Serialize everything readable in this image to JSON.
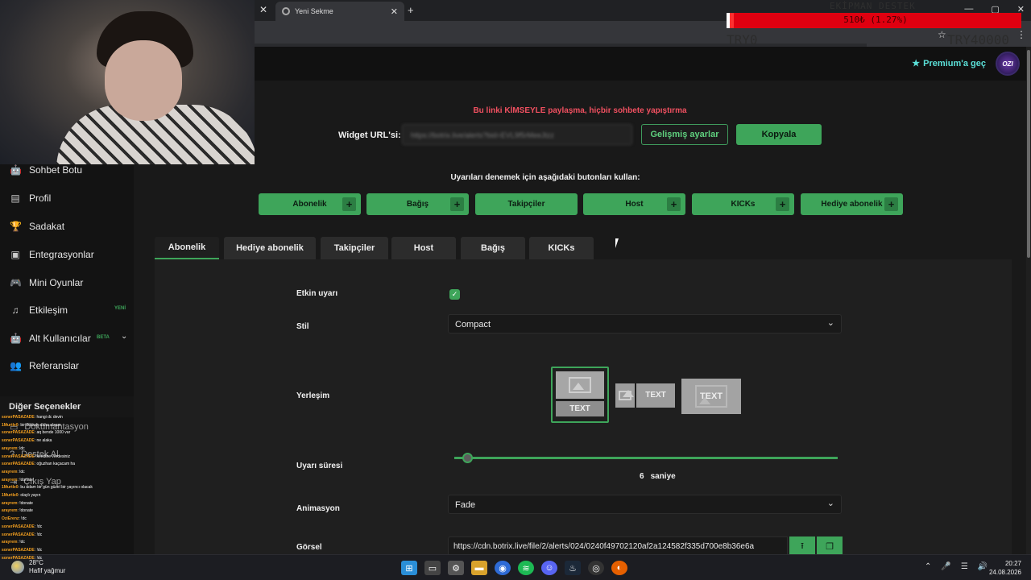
{
  "browser": {
    "tab_title": "Yeni Sekme",
    "new_tab": "+",
    "close_glyph": "✕",
    "window_controls": [
      "—",
      "▢",
      "✕"
    ]
  },
  "donation_overlay": {
    "title": "EKİPMAN DESTEK",
    "progress_text": "510₺ (1.27%)",
    "progress_percent": 1.27,
    "current": "TRY0",
    "goal": "TRY40000",
    "color": "#e00010"
  },
  "header": {
    "premium_label": "Premium'a geç",
    "avatar_text": "OZI"
  },
  "sidebar": {
    "items": [
      {
        "label": "Sohbet Botu",
        "icon": "robot-icon",
        "glyph": "🤖"
      },
      {
        "label": "Profil",
        "icon": "profile-card-icon",
        "glyph": "▤"
      },
      {
        "label": "Sadakat",
        "icon": "trophy-icon",
        "glyph": "🏆"
      },
      {
        "label": "Entegrasyonlar",
        "icon": "integration-icon",
        "glyph": "▣"
      },
      {
        "label": "Mini Oyunlar",
        "icon": "gamepad-icon",
        "glyph": "🎮"
      },
      {
        "label": "Etkileşim",
        "icon": "music-icon",
        "glyph": "♫",
        "badge": "YENİ"
      },
      {
        "label": "Alt Kullanıcılar",
        "icon": "robot-icon",
        "glyph": "🤖",
        "badge": "BETA"
      },
      {
        "label": "Referanslar",
        "icon": "users-icon",
        "glyph": "👥"
      }
    ],
    "other_options_title": "Diğer Seçenekler",
    "other_items": [
      "Dokümantasyon",
      "Destek Al",
      "Çıkış Yap"
    ]
  },
  "chat": [
    {
      "user": "sonerPASAZADE",
      "text": ": hangi dc devin"
    },
    {
      "user": "1Murtle0",
      "text": ": bir dükkan daha alsam"
    },
    {
      "user": "sonerPASAZADE",
      "text": ": aq bende 1000 var"
    },
    {
      "user": "sonerPASAZADE",
      "text": ": ne alaka"
    },
    {
      "user": "arayrem",
      "text": ": ldc"
    },
    {
      "user": "sonerPASAZADE",
      "text": ": kendine verdesiniz"
    },
    {
      "user": "sonerPASAZADE",
      "text": ": oğuzhan kaçacam ha"
    },
    {
      "user": "arayrem",
      "text": ": ldc"
    },
    {
      "user": "arayrem",
      "text": ": !donate"
    },
    {
      "user": "1Murtle0",
      "text": ": bu adam bir gün güzel bir yayıncı olacak"
    },
    {
      "user": "1Murtle0",
      "text": ": olaylı yayın"
    },
    {
      "user": "arayrem",
      "text": ": !donate"
    },
    {
      "user": "arayrem",
      "text": ": !donate"
    },
    {
      "user": "OziErenz",
      "text": ": !dc"
    },
    {
      "user": "sonerPASAZADE",
      "text": ": !dc"
    },
    {
      "user": "sonerPASAZADE",
      "text": ": !dc"
    },
    {
      "user": "arayrem",
      "text": ": !dc"
    },
    {
      "user": "sonerPASAZADE",
      "text": ": !dc"
    },
    {
      "user": "sonerPASAZADE",
      "text": ": !dc"
    }
  ],
  "widget": {
    "warning": "Bu linki KİMSEYLE paylaşma, hiçbir sohbete yapıştırma",
    "url_label": "Widget URL'si:",
    "url_value": "https://botrix.live/alerts?bid=EVL9f5rMeeJtzz",
    "advanced_label": "Gelişmiş ayarlar",
    "copy_label": "Kopyala"
  },
  "test": {
    "label": "Uyarıları denemek için aşağıdaki butonları kullan:",
    "buttons": [
      {
        "label": "Abonelik",
        "plus": true
      },
      {
        "label": "Bağış",
        "plus": true
      },
      {
        "label": "Takipçiler",
        "plus": false
      },
      {
        "label": "Host",
        "plus": true
      },
      {
        "label": "KICKs",
        "plus": true
      },
      {
        "label": "Hediye abonelik",
        "plus": true
      }
    ]
  },
  "tabs": [
    {
      "label": "Abonelik",
      "active": true
    },
    {
      "label": "Hediye abonelik",
      "active": false
    },
    {
      "label": "Takipçiler",
      "active": false
    },
    {
      "label": "Host",
      "active": false
    },
    {
      "label": "Bağış",
      "active": false
    },
    {
      "label": "KICKs",
      "active": false
    }
  ],
  "form": {
    "enabled_label": "Etkin uyarı",
    "enabled": true,
    "style_label": "Stil",
    "style_value": "Compact",
    "layout_label": "Yerleşim",
    "layout_text": "TEXT",
    "duration_label": "Uyarı süresi",
    "duration_value": "6",
    "duration_unit": "saniye",
    "duration_min": 0,
    "duration_max": 300,
    "animation_label": "Animasyon",
    "animation_value": "Fade",
    "image_label": "Görsel",
    "image_url": "https://cdn.botrix.live/file/2/alerts/024/0240f49702120af2a124582f335d700e8b36e6a"
  },
  "taskbar": {
    "temp": "28°C",
    "weather": "Hafif yağmur",
    "time": "20:27",
    "date": "24.08.2026"
  },
  "colors": {
    "accent": "#3ea55a",
    "warning": "#f05060",
    "premium": "#5be0d8"
  }
}
